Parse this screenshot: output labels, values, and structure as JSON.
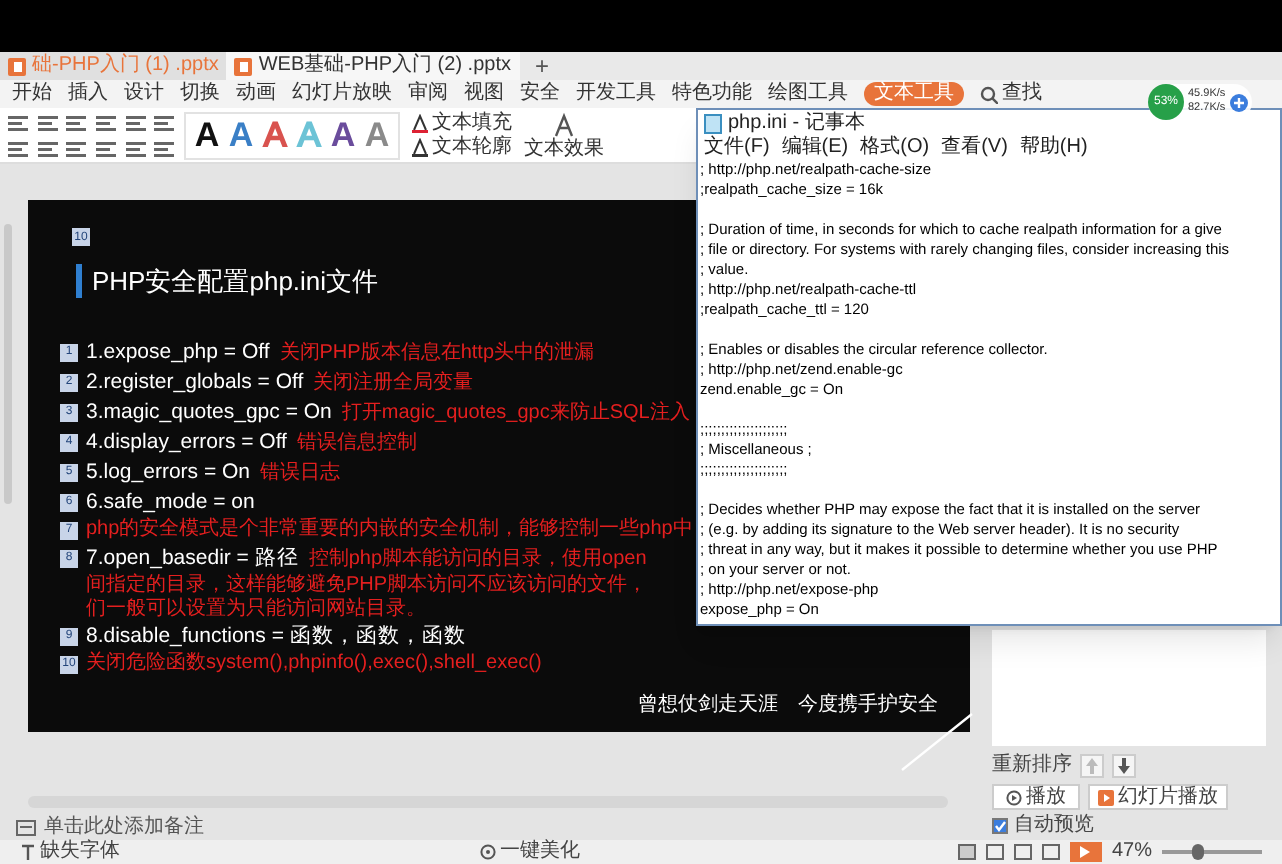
{
  "document_tabs": [
    {
      "label": "础-PHP入门 (1) .pptx",
      "selected": false
    },
    {
      "label": "WEB基础-PHP入门 (2) .pptx",
      "selected": true
    }
  ],
  "new_tab": "+",
  "ribbon_tabs": [
    {
      "label": "开始",
      "selected": false
    },
    {
      "label": "插入",
      "selected": false
    },
    {
      "label": "设计",
      "selected": false
    },
    {
      "label": "切换",
      "selected": false
    },
    {
      "label": "动画",
      "selected": false
    },
    {
      "label": "幻灯片放映",
      "selected": false
    },
    {
      "label": "审阅",
      "selected": false
    },
    {
      "label": "视图",
      "selected": false
    },
    {
      "label": "安全",
      "selected": false
    },
    {
      "label": "开发工具",
      "selected": false
    },
    {
      "label": "特色功能",
      "selected": false
    },
    {
      "label": "绘图工具",
      "selected": false
    },
    {
      "label": "文本工具",
      "selected": true
    }
  ],
  "search": "查找",
  "tools": {
    "text_styles": [
      {
        "letter": "A",
        "kind": "solid",
        "color": "#111111"
      },
      {
        "letter": "A",
        "kind": "solid",
        "color": "#3a7fc6"
      },
      {
        "letter": "A",
        "kind": "outline",
        "color": "#d9534f"
      },
      {
        "letter": "A",
        "kind": "outline",
        "color": "#6cc3d6"
      },
      {
        "letter": "A",
        "kind": "solid",
        "color": "#6a4c9c"
      },
      {
        "letter": "A",
        "kind": "solid",
        "color": "#8a8a8a"
      }
    ],
    "fill": "文本填充",
    "outline": "文本轮廓",
    "effect": "文本效果"
  },
  "slide": {
    "page_badge": "10",
    "title": "PHP安全配置php.ini文件",
    "items": [
      {
        "kind": "setting",
        "badge": "1",
        "code": "1.expose_php = Off",
        "note": "关闭PHP版本信息在http头中的泄漏"
      },
      {
        "kind": "setting",
        "badge": "2",
        "code": "2.register_globals = Off",
        "note": "关闭注册全局变量"
      },
      {
        "kind": "setting",
        "badge": "3",
        "code": "3.magic_quotes_gpc = On",
        "note": "打开magic_quotes_gpc来防止SQL注入"
      },
      {
        "kind": "setting",
        "badge": "4",
        "code": "4.display_errors = Off",
        "note": "错误信息控制"
      },
      {
        "kind": "setting",
        "badge": "5",
        "code": "5.log_errors = On",
        "note": "错误日志"
      },
      {
        "kind": "setting",
        "badge": "6",
        "code": "6.safe_mode = on"
      },
      {
        "kind": "note",
        "badge": "7",
        "note": "php的安全模式是个非常重要的内嵌的安全机制，能够控制一些php中"
      },
      {
        "kind": "setting",
        "badge": "8",
        "code": "7.open_basedir = 路径",
        "note": "控制php脚本能访问的目录，使用open",
        "more": [
          "间指定的目录，这样能够避免PHP脚本访问不应该访问的文件，",
          "们一般可以设置为只能访问网站目录。"
        ]
      },
      {
        "kind": "setting",
        "badge": "9",
        "code": "8.disable_functions = 函数，函数，函数"
      },
      {
        "kind": "note",
        "badge": "10",
        "note": "关闭危险函数system(),phpinfo(),exec(),shell_exec()"
      }
    ],
    "footer": [
      "曾想仗剑走天涯",
      "今度携手护安全"
    ]
  },
  "notepad": {
    "title": "php.ini - 记事本",
    "menu": [
      "文件(F)",
      "编辑(E)",
      "格式(O)",
      "查看(V)",
      "帮助(H)"
    ],
    "blocks": [
      [
        "; http://php.net/realpath-cache-size",
        ";realpath_cache_size = 16k"
      ],
      [
        "; Duration of time, in seconds for which to cache realpath information for a give",
        "; file or directory. For systems with rarely changing files, consider increasing this",
        "; value.",
        "; http://php.net/realpath-cache-ttl",
        ";realpath_cache_ttl = 120"
      ],
      [
        "; Enables or disables the circular reference collector.",
        "; http://php.net/zend.enable-gc",
        "zend.enable_gc = On"
      ],
      [
        ";;;;;;;;;;;;;;;;;;;;;",
        "; Miscellaneous ;",
        ";;;;;;;;;;;;;;;;;;;;;"
      ],
      [
        "; Decides whether PHP may expose the fact that it is installed on the server",
        "; (e.g. by adding its signature to the Web server header).  It is no security",
        "; threat in any way, but it makes it possible to determine whether you use PHP",
        "; on your server or not.",
        "; http://php.net/expose-php",
        "expose_php = On"
      ]
    ]
  },
  "speed_widget": {
    "percent": "53%",
    "upload": "45.9K/s",
    "download": "82.7K/s"
  },
  "right_panel": {
    "reorder": "重新排序",
    "play": "播放",
    "slideshow": "幻灯片播放",
    "auto_preview": {
      "label": "自动预览",
      "checked": true
    }
  },
  "notes": "单击此处添加备注",
  "status_bar": {
    "missing_fonts": "缺失字体",
    "beautify": "一键美化",
    "zoom": "47%",
    "zoom_slider": {
      "level": 0.3
    }
  }
}
